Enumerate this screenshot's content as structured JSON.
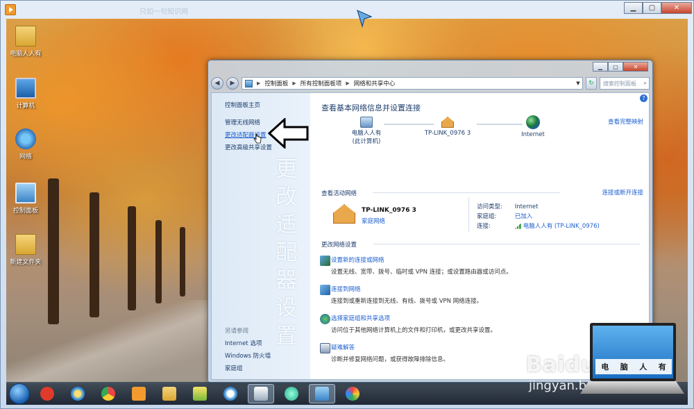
{
  "outer": {
    "ghost_title": "只如一句知识网"
  },
  "desktop_icons": [
    {
      "label": "电脑人人有"
    },
    {
      "label": "计算机"
    },
    {
      "label": "网络"
    },
    {
      "label": "控制面板"
    },
    {
      "label": "新建文件夹"
    }
  ],
  "window": {
    "breadcrumbs": [
      "控制面板",
      "所有控制面板项",
      "网络和共享中心"
    ],
    "search_placeholder": "搜索控制面板",
    "left_pane": {
      "home": "控制面板主页",
      "links": [
        "管理无线网络",
        "更改适配器设置",
        "更改高级共享设置"
      ],
      "see_also_heading": "另请参阅",
      "see_also": [
        "Internet 选项",
        "Windows 防火墙",
        "家庭组"
      ],
      "watermark": "更改适配器设置"
    },
    "main": {
      "title": "查看基本网络信息并设置连接",
      "full_map_link": "查看完整映射",
      "nodes": [
        {
          "line1": "电脑人人有",
          "line2": "(此计算机)"
        },
        {
          "line1": "TP-LINK_0976  3",
          "line2": ""
        },
        {
          "line1": "Internet",
          "line2": ""
        }
      ],
      "active_heading": "查看活动网络",
      "connect_link": "连接或断开连接",
      "active_network": {
        "name": "TP-LINK_0976  3",
        "type": "家庭网络"
      },
      "props": [
        {
          "key": "访问类型:",
          "value": "Internet"
        },
        {
          "key": "家庭组:",
          "value": "已加入"
        },
        {
          "key": "连接:",
          "value": "电脑人人有 (TP-LINK_0976)"
        }
      ],
      "change_heading": "更改网络设置",
      "tasks": [
        {
          "title": "设置新的连接或网络",
          "desc": "设置无线、宽带、拨号、临时或 VPN 连接；或设置路由器或访问点。"
        },
        {
          "title": "连接到网络",
          "desc": "连接到或重新连接到无线、有线、拨号或 VPN 网络连接。"
        },
        {
          "title": "选择家庭组和共享选项",
          "desc": "访问位于其他网络计算机上的文件和打印机，或更改共享设置。"
        },
        {
          "title": "疑难解答",
          "desc": "诊断并修复网络问题，或获得故障排除信息。"
        }
      ]
    }
  },
  "baidu": {
    "logo": "Baidu经验",
    "url": "jingyan.baidu.com",
    "laptop_label": [
      "电",
      "脑",
      "人",
      "有"
    ]
  },
  "colors": {
    "link": "#1c5fd0",
    "text": "#1e3e6e",
    "taskbar": "#1e2c3c"
  }
}
